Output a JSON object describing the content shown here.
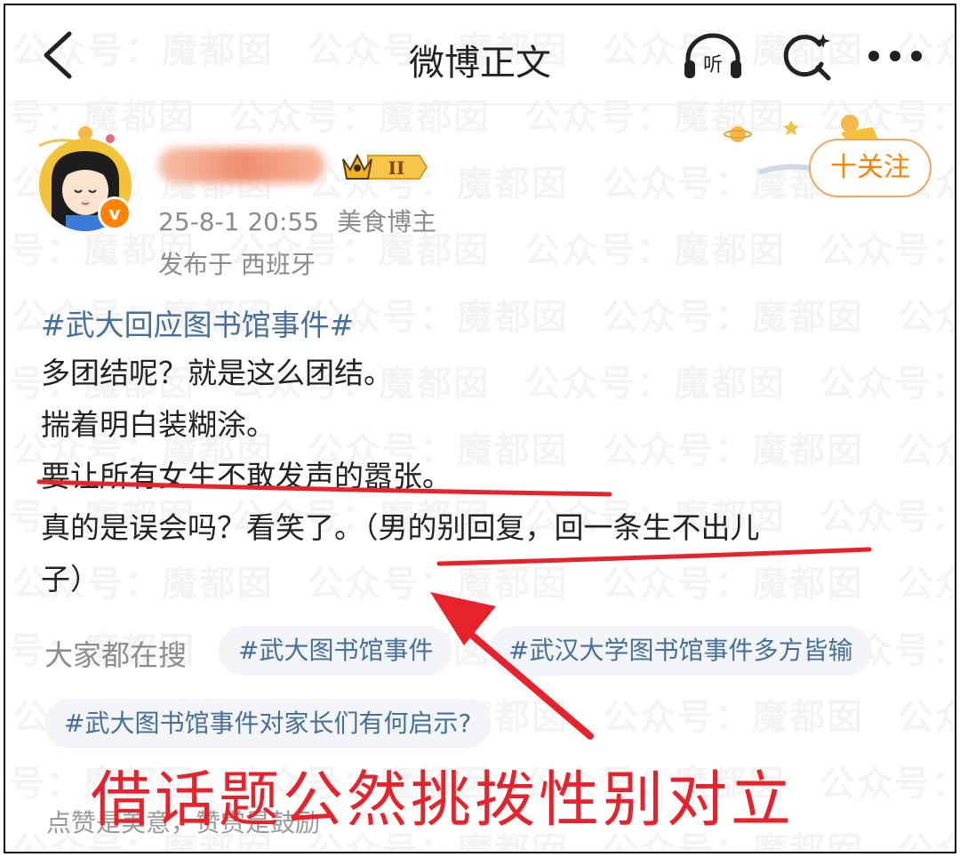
{
  "header": {
    "title": "微博正文",
    "listen_label": "听"
  },
  "author": {
    "time": "25-8-1 20:55",
    "tag": "美食博主",
    "location": "发布于 西班牙",
    "level_badge": "II",
    "verified_mark": "v",
    "follow_label": "十关注"
  },
  "post": {
    "topic": "#武大回应图书馆事件#",
    "lines": [
      "多团结呢？就是这么团结。",
      "揣着明白装糊涂。",
      "要让所有女生不敢发声的嚣张。",
      "真的是误会吗？看笑了。（男的别回复，回一条生不出儿",
      "子）"
    ]
  },
  "searches": {
    "label": "大家都在搜",
    "items": [
      "#武大图书馆事件",
      "#武汉大学图书馆事件多方皆输",
      "#武大图书馆事件对家长们有何启示?"
    ]
  },
  "footer": {
    "likes_hint": "点赞是美意，赞赏是鼓励"
  },
  "watermark": {
    "text": "公众号：魔都囡"
  },
  "annotation": {
    "caption": "借话题公然挑拨性别对立",
    "color": "#e8222b"
  },
  "colors": {
    "topic": "#466f9b",
    "follow": "#ff8200",
    "muted": "#8b8b8b"
  }
}
